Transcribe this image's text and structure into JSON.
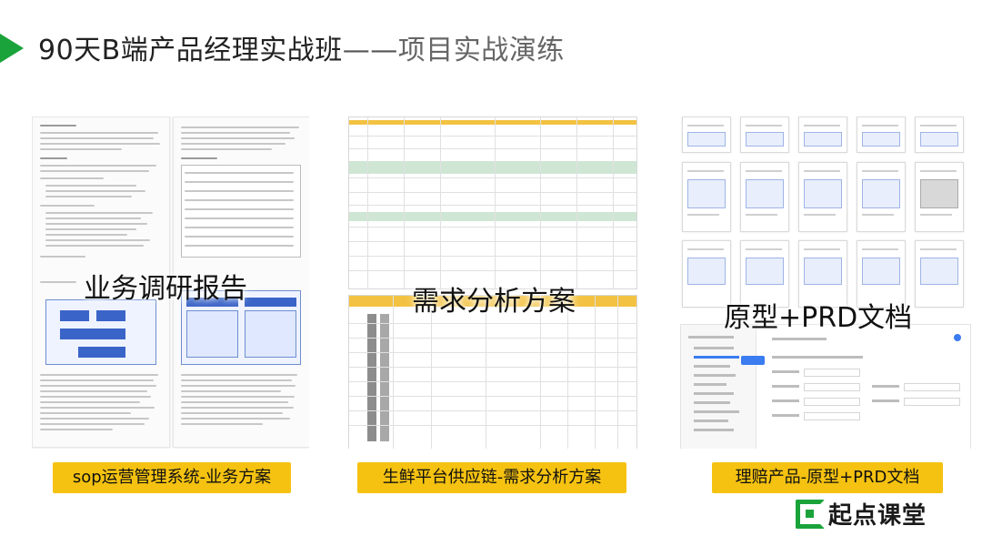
{
  "header": {
    "title_main": "90天B端产品经理实战班",
    "title_dash": "——",
    "title_sub": "项目实战演练"
  },
  "panels": [
    {
      "overlay": "业务调研报告",
      "caption": "sop运营管理系统-业务方案"
    },
    {
      "overlay": "需求分析方案",
      "caption": "生鲜平台供应链-需求分析方案"
    },
    {
      "overlay": "原型+PRD文档",
      "caption": "理赔产品-原型+PRD文档"
    }
  ],
  "brand": {
    "name": "起点课堂",
    "icon": "qidian-logo-icon"
  },
  "colors": {
    "accent_green": "#1aa33a",
    "caption_yellow": "#f5c211"
  }
}
